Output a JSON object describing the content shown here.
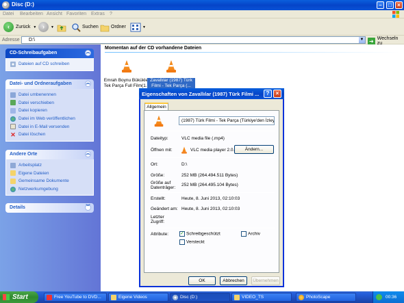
{
  "window": {
    "title": "Disc (D:)",
    "controls": [
      "minimize-icon",
      "maximize-icon",
      "close-icon"
    ]
  },
  "menu": [
    "Datei",
    "Bearbeiten",
    "Ansicht",
    "Favoriten",
    "Extras",
    "?"
  ],
  "toolbar": {
    "back_label": "Zurück",
    "search_label": "Suchen",
    "folders_label": "Ordner"
  },
  "address": {
    "label": "Adresse",
    "value": "D:\\",
    "go_label": "Wechseln zu"
  },
  "taskpane": {
    "cd_tasks": {
      "title": "CD-Schreibaufgaben",
      "items": [
        "Dateien auf CD schreiben"
      ]
    },
    "file_tasks": {
      "title": "Datei- und Ordneraufgaben",
      "items": [
        "Datei umbenennen",
        "Datei verschieben",
        "Datei kopieren",
        "Datei im Web veröffentlichen",
        "Datei in E-Mail versenden",
        "Datei löschen"
      ]
    },
    "other_places": {
      "title": "Andere Orte",
      "items": [
        "Arbeitsplatz",
        "Eigene Dateien",
        "Gemeinsame Dokumente",
        "Netzwerkumgebung"
      ]
    },
    "details": {
      "title": "Details"
    }
  },
  "content": {
    "section_title": "Momentan auf der CD vorhandene Dateien",
    "files": [
      {
        "name_line1": "Emrah Boynu Bükükler",
        "name_line2": "Tek Parça Full Film(1...",
        "selected": false
      },
      {
        "name_line1": "Zavallılar (1987) Türk",
        "name_line2": "Filmi - Tek Parça (...",
        "selected": true
      }
    ]
  },
  "dialog": {
    "title": "Eigenschaften von Zavallılar (1987) Türk Filmi ...",
    "tab": "Allgemein",
    "filename": "(1987) Türk Filmi - Tek Parça (Türkiye'den İzleye",
    "filetype_label": "Dateityp:",
    "filetype_value": "VLC media file (.mp4)",
    "openwith_label": "Öffnen mit:",
    "openwith_value": "VLC media player 2.0.",
    "change_button": "Ändern...",
    "location_label": "Ort:",
    "location_value": "D:\\",
    "size_label": "Größe:",
    "size_value": "252 MB (264.494.511 Bytes)",
    "size_on_disk_label_1": "Größe auf",
    "size_on_disk_label_2": "Datenträger:",
    "size_on_disk_value": "252 MB (264.495.104 Bytes)",
    "created_label": "Erstellt:",
    "created_value": "Heute, 8. Juni 2013, 02:10:03",
    "modified_label": "Geändert am:",
    "modified_value": "Heute, 8. Juni 2013, 02:10:03",
    "accessed_label_1": "Letzter",
    "accessed_label_2": "Zugriff:",
    "attributes_label": "Attribute:",
    "readonly_label": "Schreibgeschützt",
    "readonly_checked": true,
    "hidden_label": "Versteckt",
    "hidden_checked": false,
    "archive_label": "Archiv",
    "archive_checked": false,
    "ok_button": "OK",
    "cancel_button": "Abbrechen",
    "apply_button": "Übernehmen"
  },
  "taskbar": {
    "start_label": "Start",
    "items": [
      "Free YouTube to DVD...",
      "Eigene Videos",
      "Disc (D:)",
      "VIDEO_TS",
      "PhotoScape"
    ],
    "clock": "00:36"
  }
}
